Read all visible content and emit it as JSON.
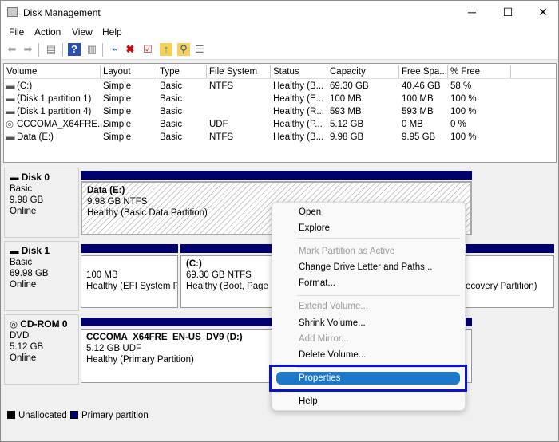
{
  "window": {
    "title": "Disk Management"
  },
  "menu": [
    "File",
    "Action",
    "View",
    "Help"
  ],
  "toolbar": [
    "back-icon",
    "forward-icon",
    "console-tree-icon",
    "help-icon",
    "action-pane-icon",
    "connect-icon",
    "delete-icon",
    "properties-icon",
    "folder-up-icon",
    "search-folder-icon",
    "list-icon"
  ],
  "columns": [
    "Volume",
    "Layout",
    "Type",
    "File System",
    "Status",
    "Capacity",
    "Free Spa...",
    "% Free"
  ],
  "volumes": [
    {
      "icon": "drive-icon",
      "cells": [
        " (C:)",
        "Simple",
        "Basic",
        "NTFS",
        "Healthy (B...",
        "69.30 GB",
        "40.46 GB",
        "58 %"
      ]
    },
    {
      "icon": "drive-icon",
      "cells": [
        "(Disk 1 partition 1)",
        "Simple",
        "Basic",
        "",
        "Healthy (E...",
        "100 MB",
        "100 MB",
        "100 %"
      ]
    },
    {
      "icon": "drive-icon",
      "cells": [
        "(Disk 1 partition 4)",
        "Simple",
        "Basic",
        "",
        "Healthy (R...",
        "593 MB",
        "593 MB",
        "100 %"
      ]
    },
    {
      "icon": "cd-drive-icon",
      "cells": [
        "CCCOMA_X64FRE...",
        "Simple",
        "Basic",
        "UDF",
        "Healthy (P...",
        "5.12 GB",
        "0 MB",
        "0 %"
      ]
    },
    {
      "icon": "drive-icon",
      "cells": [
        "Data (E:)",
        "Simple",
        "Basic",
        "NTFS",
        "Healthy (B...",
        "9.98 GB",
        "9.95 GB",
        "100 %"
      ]
    }
  ],
  "disks": [
    {
      "name": "Disk 0",
      "type": "Basic",
      "size": "9.98 GB",
      "state": "Online",
      "partitions": [
        {
          "title": "Data  (E:)",
          "size": "9.98 GB NTFS",
          "status": "Healthy (Basic Data Partition)"
        }
      ]
    },
    {
      "name": "Disk 1",
      "type": "Basic",
      "size": "69.98 GB",
      "state": "Online",
      "partitions": [
        {
          "title": "",
          "size": "100 MB",
          "status": "Healthy (EFI System Pa"
        },
        {
          "title": "(C:)",
          "size": "69.30 GB NTFS",
          "status": "Healthy (Boot, Page Fi"
        },
        {
          "title": "",
          "size": "",
          "status": "ecovery Partition)"
        }
      ]
    },
    {
      "name": "CD-ROM 0",
      "type": "DVD",
      "size": "5.12 GB",
      "state": "Online",
      "partitions": [
        {
          "title": "CCCOMA_X64FRE_EN-US_DV9  (D:)",
          "size": "5.12 GB UDF",
          "status": "Healthy (Primary Partition)"
        }
      ]
    }
  ],
  "legend": [
    {
      "label": "Unallocated",
      "color": "#000000"
    },
    {
      "label": "Primary partition",
      "color": "#00006e"
    }
  ],
  "context_menu": {
    "items": [
      {
        "label": "Open",
        "disabled": false
      },
      {
        "label": "Explore",
        "disabled": false
      },
      {
        "label": "Mark Partition as Active",
        "disabled": true
      },
      {
        "label": "Change Drive Letter and Paths...",
        "disabled": false
      },
      {
        "label": "Format...",
        "disabled": false
      },
      {
        "label": "Extend Volume...",
        "disabled": true
      },
      {
        "label": "Shrink Volume...",
        "disabled": false
      },
      {
        "label": "Add Mirror...",
        "disabled": true
      },
      {
        "label": "Delete Volume...",
        "disabled": false
      },
      {
        "label": "Properties",
        "disabled": false,
        "highlighted": true
      },
      {
        "label": "Help",
        "disabled": false
      }
    ]
  },
  "colors": {
    "highlight": "#1e78c8",
    "annotation_box": "#0a14d0",
    "partition_bar": "#00006e"
  }
}
